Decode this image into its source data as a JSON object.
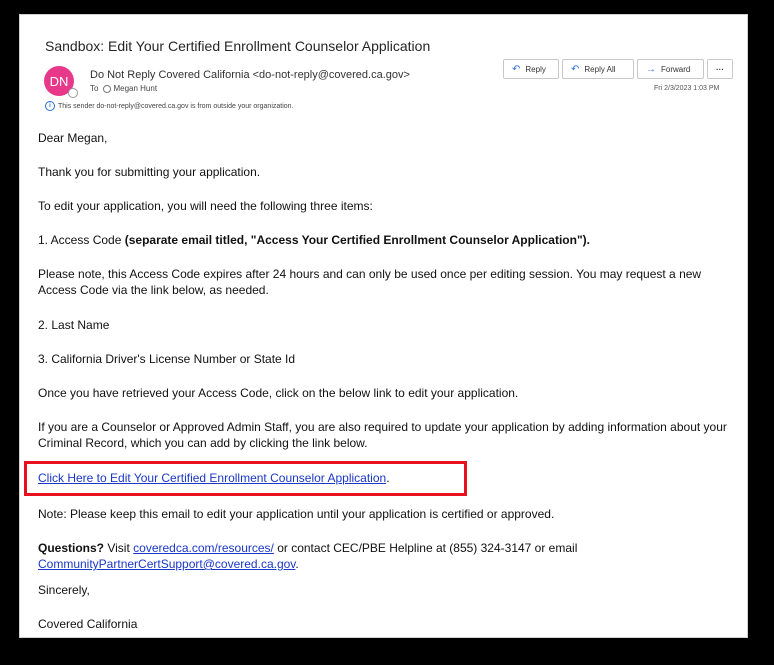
{
  "email": {
    "subject": "Sandbox: Edit Your Certified Enrollment Counselor Application",
    "avatar_initials": "DN",
    "sender": "Do Not Reply Covered California <do-not-reply@covered.ca.gov>",
    "to_label": "To",
    "to_name": "Megan Hunt",
    "external_note": "This sender do-not-reply@covered.ca.gov is from outside your organization.",
    "datetime": "Fri 2/3/2023 1:03 PM"
  },
  "actions": {
    "reply": "Reply",
    "reply_all": "Reply All",
    "forward": "Forward",
    "more": "···"
  },
  "body": {
    "greeting": "Dear Megan,",
    "thanks": "Thank you for submitting your application.",
    "intro": "To edit your application, you will need the following three items:",
    "item1_label": "1. Access Code ",
    "item1_bold": "(separate email titled, \"Access Your Certified Enrollment Counselor Application\").",
    "note_access": "Please note, this Access Code expires after 24 hours and can only be used once per editing session. You may request a new Access Code via the link below, as needed.",
    "item2": "2. Last Name",
    "item3": "3. California Driver's License Number or State Id",
    "retrieved": "Once you have retrieved your Access Code, click on the below link to edit your application.",
    "counselor": "If you are a Counselor or Approved Admin Staff, you are also required to update your application by adding information about your Criminal Record, which you can add by clicking the link below.",
    "edit_link": "Click Here to Edit Your Certified Enrollment Counselor Application",
    "edit_link_tail": ".",
    "keep_note": "Note: Please keep this email to edit your application until your application is certified or approved.",
    "questions_bold": "Questions?",
    "questions_visit": " Visit ",
    "resources_link": "coveredca.com/resources/",
    "questions_contact": " or contact CEC/PBE Helpline at (855) 324-3147 or email ",
    "support_link": "CommunityPartnerCertSupport@covered.ca.gov",
    "questions_tail": ".",
    "sincerely": "Sincerely,",
    "signature": "Covered California"
  },
  "colors": {
    "avatar": "#e8388a",
    "link": "#1a37c8",
    "highlight": "#e8101c"
  }
}
